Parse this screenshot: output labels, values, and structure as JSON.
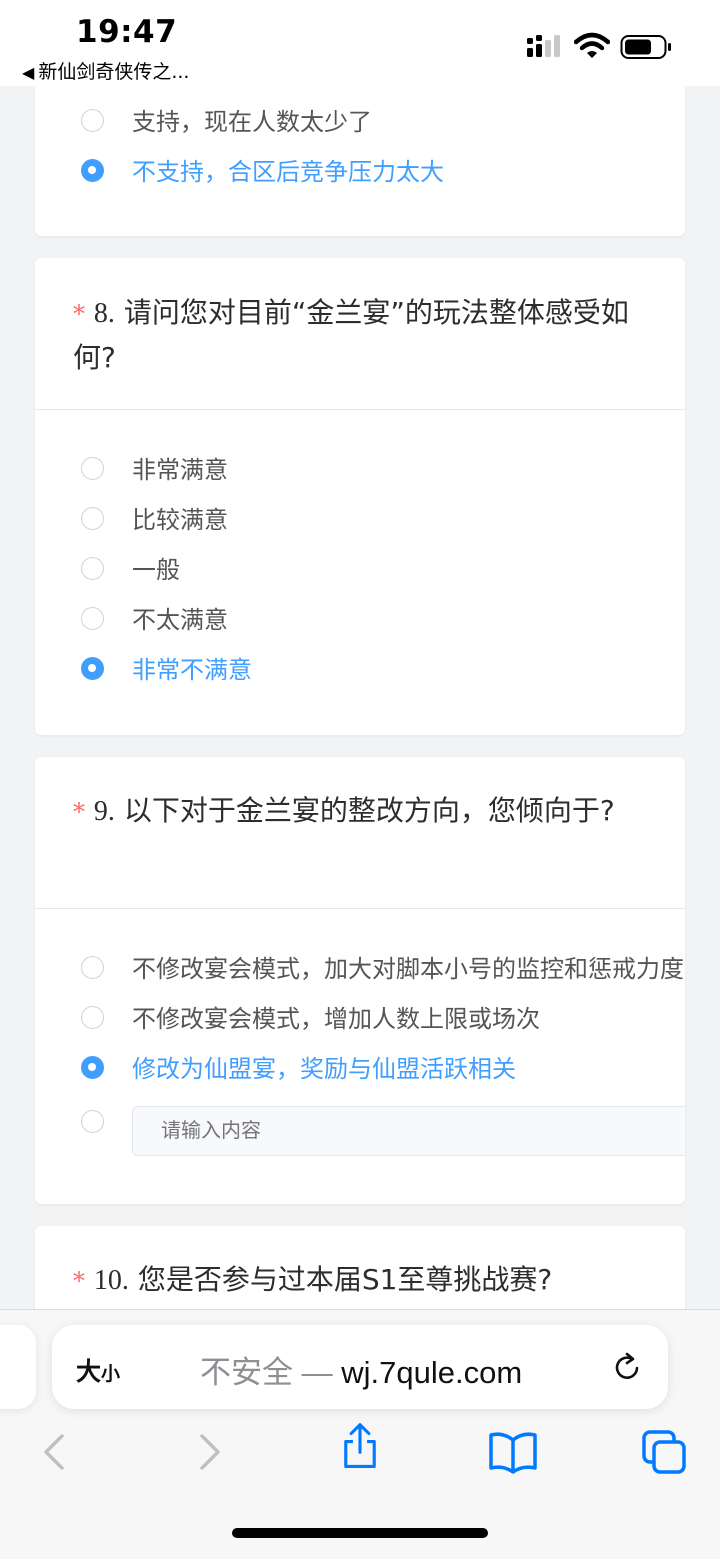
{
  "status_bar": {
    "time": "19:47",
    "back_app": "新仙剑奇侠传之..."
  },
  "q7": {
    "options": [
      {
        "label": "支持，现在人数太少了",
        "selected": false
      },
      {
        "label": "不支持，合区后竞争压力太大",
        "selected": true
      }
    ]
  },
  "q8": {
    "required_mark": "*",
    "number": "8.",
    "title": "请问您对目前“金兰宴”的玩法整体感受如何?",
    "options": [
      {
        "label": "非常满意",
        "selected": false
      },
      {
        "label": "比较满意",
        "selected": false
      },
      {
        "label": "一般",
        "selected": false
      },
      {
        "label": "不太满意",
        "selected": false
      },
      {
        "label": "非常不满意",
        "selected": true
      }
    ]
  },
  "q9": {
    "required_mark": "*",
    "number": "9.",
    "title": "以下对于金兰宴的整改方向，您倾向于?",
    "options": [
      {
        "label": "不修改宴会模式，加大对脚本小号的监控和惩戒力度",
        "selected": false
      },
      {
        "label": "不修改宴会模式，增加人数上限或场次",
        "selected": false
      },
      {
        "label": "修改为仙盟宴，奖励与仙盟活跃相关",
        "selected": true
      }
    ],
    "other_placeholder": "请输入内容"
  },
  "q10": {
    "required_mark": "*",
    "number": "10.",
    "title": "您是否参与过本届S1至尊挑战赛?"
  },
  "browser": {
    "text_size_big": "大",
    "text_size_small": "小",
    "insecure_label": "不安全",
    "separator": "—",
    "domain": "wj.7qule.com"
  },
  "colors": {
    "accent": "#409eff",
    "required": "#f56c6c",
    "ios_blue": "#007aff"
  }
}
